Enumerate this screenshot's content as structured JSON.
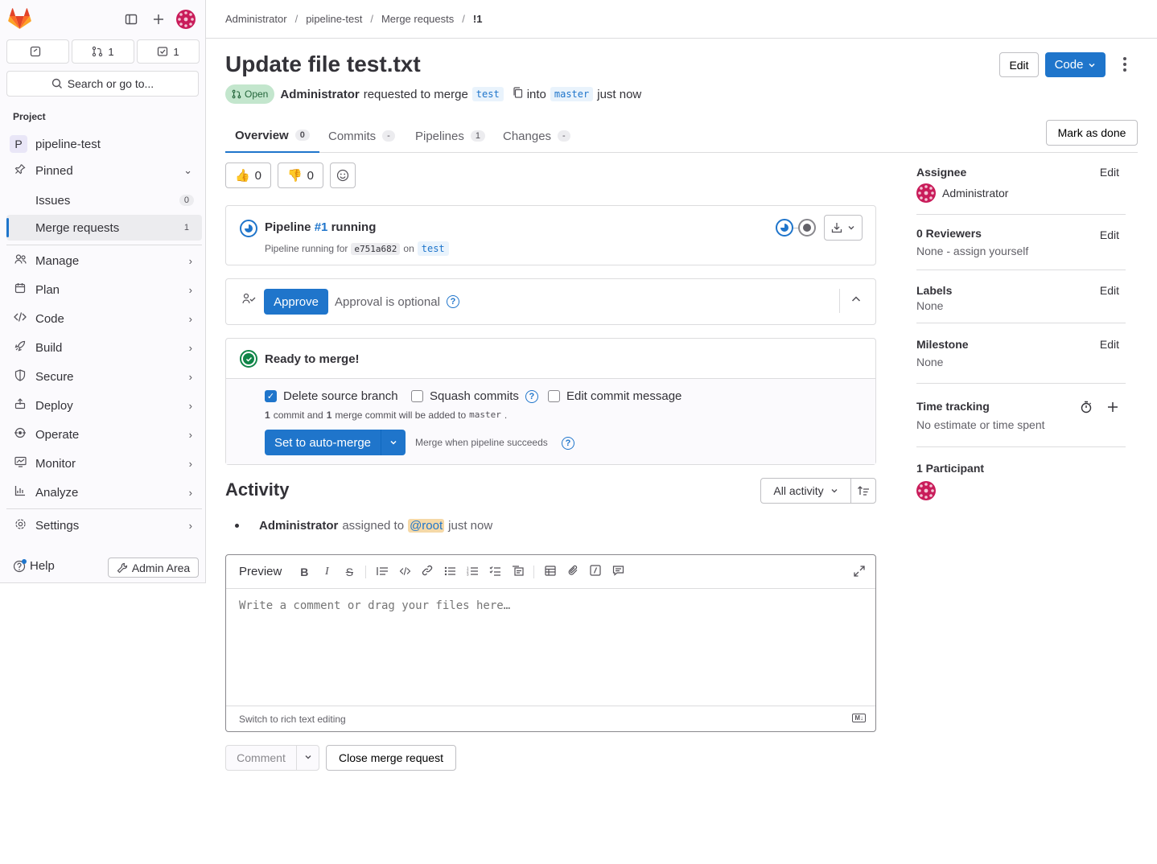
{
  "sidebar": {
    "counters": [
      {
        "icon": "issues-icon",
        "count": ""
      },
      {
        "icon": "merge-request-icon",
        "count": "1"
      },
      {
        "icon": "todo-icon",
        "count": "1"
      }
    ],
    "search_label": "Search or go to...",
    "section_title": "Project",
    "project": {
      "initial": "P",
      "name": "pipeline-test"
    },
    "pinned": {
      "label": "Pinned",
      "items": [
        {
          "label": "Issues",
          "count": "0"
        },
        {
          "label": "Merge requests",
          "count": "1"
        }
      ]
    },
    "nav": [
      {
        "label": "Manage",
        "icon": "users-icon"
      },
      {
        "label": "Plan",
        "icon": "calendar-icon"
      },
      {
        "label": "Code",
        "icon": "code-icon"
      },
      {
        "label": "Build",
        "icon": "rocket-icon"
      },
      {
        "label": "Secure",
        "icon": "shield-icon"
      },
      {
        "label": "Deploy",
        "icon": "deploy-icon"
      },
      {
        "label": "Operate",
        "icon": "cloud-icon"
      },
      {
        "label": "Monitor",
        "icon": "monitor-icon"
      },
      {
        "label": "Analyze",
        "icon": "chart-icon"
      }
    ],
    "settings_label": "Settings",
    "help_label": "Help",
    "admin_label": "Admin Area"
  },
  "breadcrumbs": [
    "Administrator",
    "pipeline-test",
    "Merge requests",
    "!1"
  ],
  "header": {
    "title": "Update file test.txt",
    "edit_label": "Edit",
    "code_label": "Code",
    "status": "Open",
    "author": "Administrator",
    "requested_text": "requested to merge",
    "source_branch": "test",
    "into_text": "into",
    "target_branch": "master",
    "time": "just now"
  },
  "tabs": [
    {
      "label": "Overview",
      "count": "0"
    },
    {
      "label": "Commits",
      "count": "-"
    },
    {
      "label": "Pipelines",
      "count": "1"
    },
    {
      "label": "Changes",
      "count": "-"
    }
  ],
  "mark_done_label": "Mark as done",
  "reactions": {
    "thumbs_up": "0",
    "thumbs_down": "0"
  },
  "pipeline": {
    "prefix": "Pipeline",
    "id": "#1",
    "status": "running",
    "sub_prefix": "Pipeline running for",
    "commit": "e751a682",
    "on_text": "on",
    "branch": "test"
  },
  "approval": {
    "approve_label": "Approve",
    "optional_text": "Approval is optional"
  },
  "merge": {
    "title": "Ready to merge!",
    "delete_branch_label": "Delete source branch",
    "delete_branch_checked": true,
    "squash_label": "Squash commits",
    "edit_msg_label": "Edit commit message",
    "commit_count": "1",
    "commit_text_1": "commit and",
    "merge_commit_count": "1",
    "commit_text_2": "merge commit will be added to",
    "target": "master",
    "auto_merge_label": "Set to auto-merge",
    "merge_when_text": "Merge when pipeline succeeds"
  },
  "activity": {
    "title": "Activity",
    "filter_label": "All activity",
    "events": [
      {
        "author": "Administrator",
        "text": "assigned to",
        "mention": "@root",
        "time": "just now"
      }
    ]
  },
  "editor": {
    "preview_label": "Preview",
    "placeholder": "Write a comment or drag your files here…",
    "footer_link": "Switch to rich text editing",
    "md_badge": "M↓"
  },
  "comment_label": "Comment",
  "close_mr_label": "Close merge request",
  "right_sidebar": {
    "assignee_title": "Assignee",
    "assignee_name": "Administrator",
    "reviewers_title": "0 Reviewers",
    "reviewers_value": "None - assign yourself",
    "labels_title": "Labels",
    "labels_value": "None",
    "milestone_title": "Milestone",
    "milestone_value": "None",
    "time_title": "Time tracking",
    "time_value": "No estimate or time spent",
    "participants_title": "1 Participant",
    "edit_label": "Edit"
  },
  "colors": {
    "accent": "#1f75cb",
    "success": "#108548",
    "avatar": "#c91c5a"
  }
}
